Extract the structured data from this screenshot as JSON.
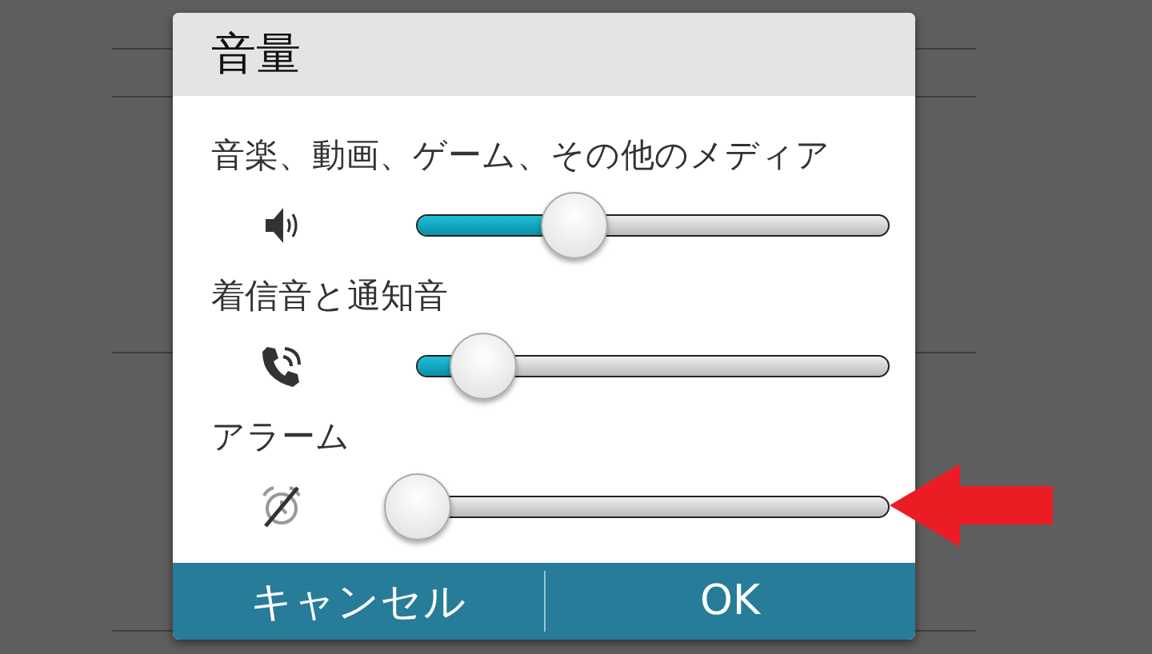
{
  "dialog": {
    "title": "音量",
    "channels": [
      {
        "kind": "media",
        "label": "音楽、動画、ゲーム、その他のメディア",
        "level": 0.33
      },
      {
        "kind": "ringtone",
        "label": "着信音と通知音",
        "level": 0.14
      },
      {
        "kind": "alarm_off",
        "label": "アラーム",
        "level": 0
      }
    ],
    "buttons": [
      "キャンセル",
      "OK"
    ]
  }
}
